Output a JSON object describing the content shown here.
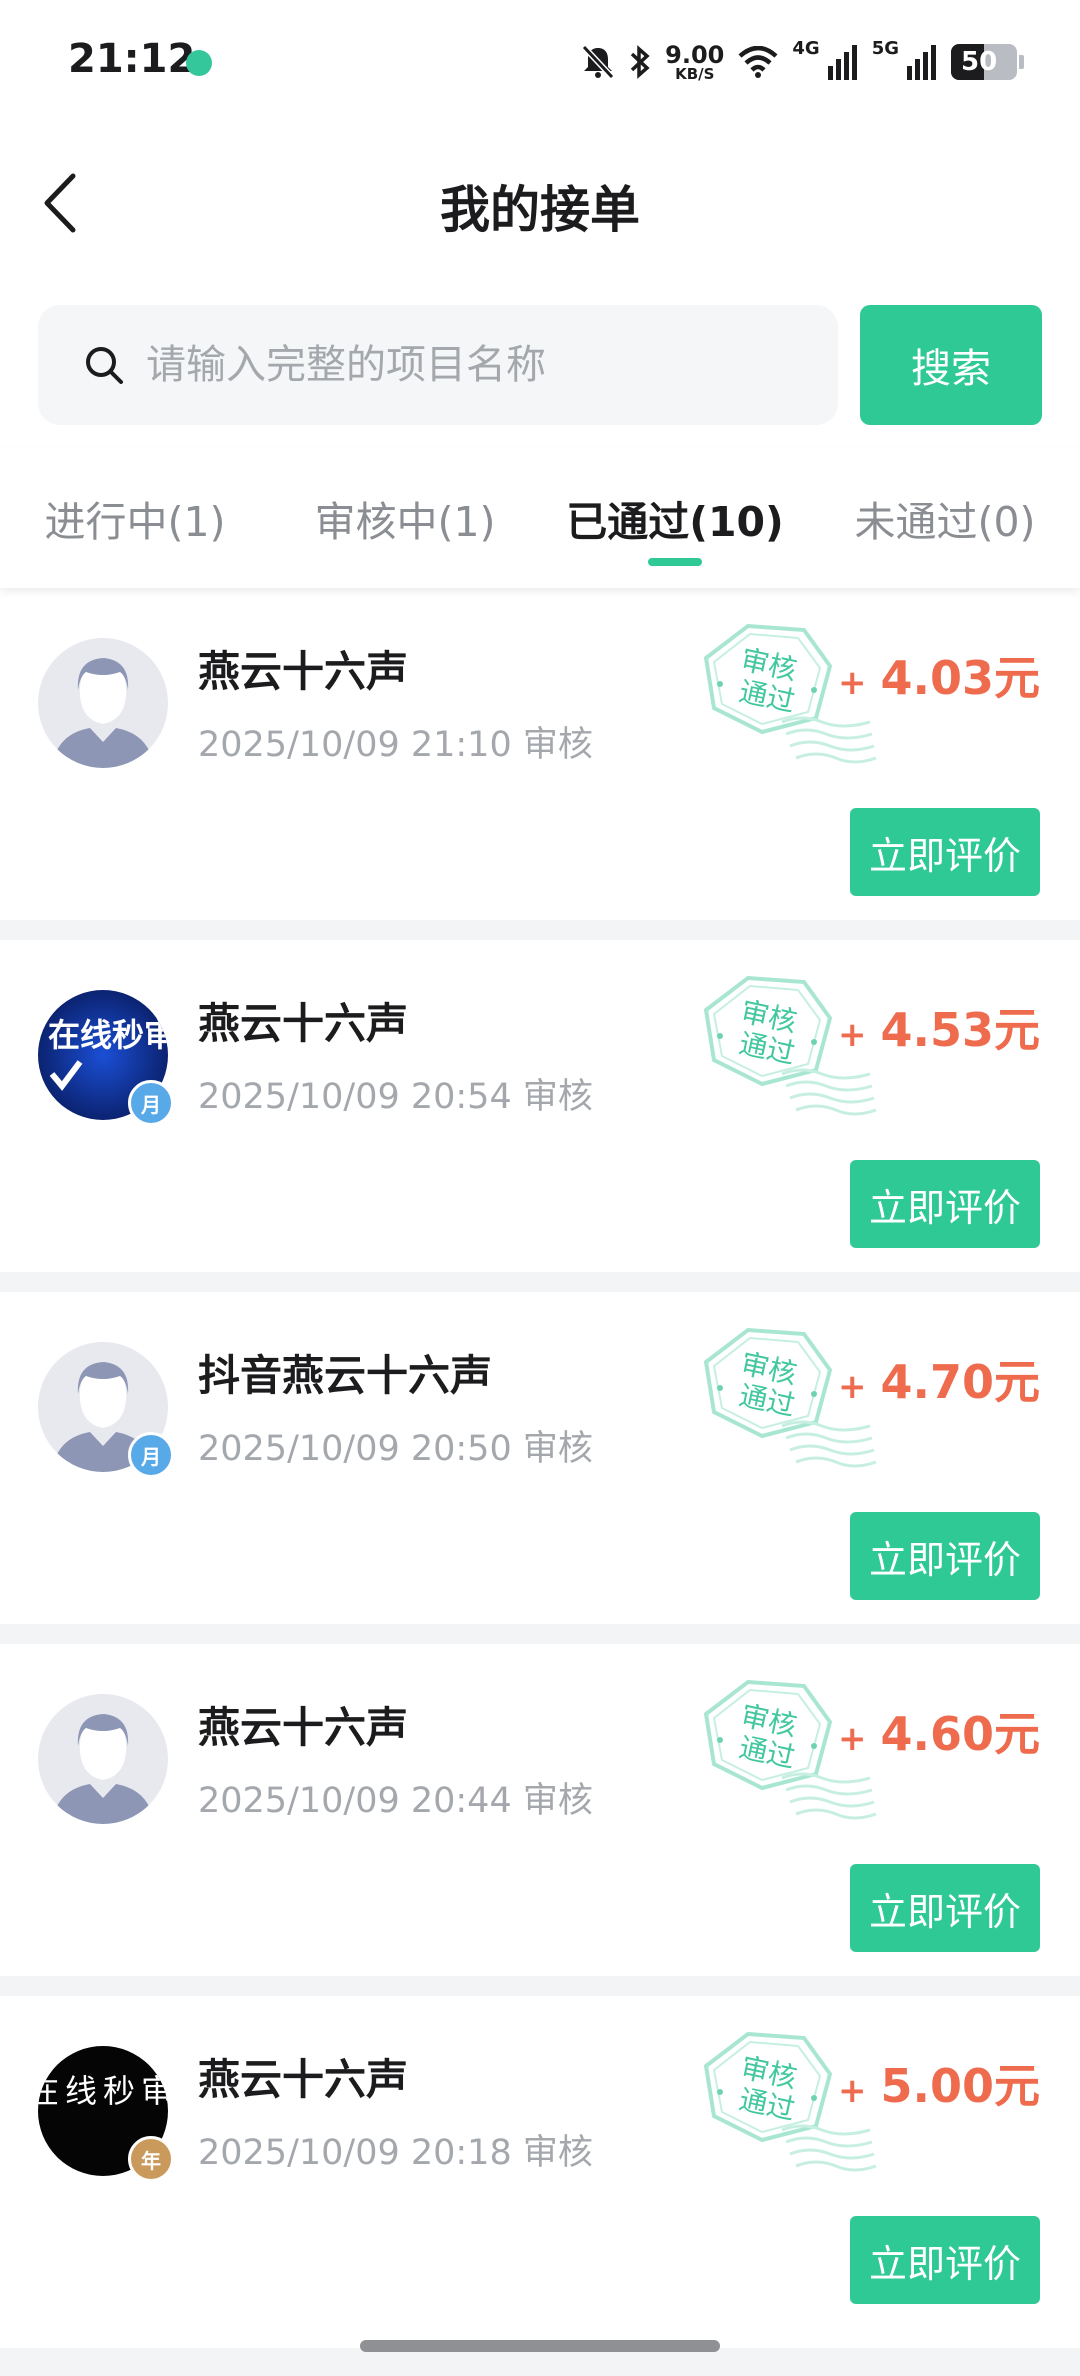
{
  "status_bar": {
    "time": "21:12",
    "speed_value": "9.00",
    "speed_unit": "KB/S",
    "net1": "4G",
    "net2": "5G",
    "battery": "50",
    "icons": [
      "mute-icon",
      "bluetooth-icon",
      "wifi-icon",
      "signal-icon",
      "signal-icon",
      "battery-icon"
    ]
  },
  "header": {
    "title": "我的接单"
  },
  "search": {
    "placeholder": "请输入完整的项目名称",
    "button_label": "搜索"
  },
  "tabs": [
    {
      "label": "进行中(1)",
      "active": false
    },
    {
      "label": "审核中(1)",
      "active": false
    },
    {
      "label": "已通过(10)",
      "active": true
    },
    {
      "label": "未通过(0)",
      "active": false
    }
  ],
  "colors": {
    "accent": "#2ec994",
    "amount": "#ee6b4d",
    "muted": "#a4a8ad"
  },
  "stamp": {
    "line1": "审核",
    "line2": "通过"
  },
  "orders": [
    {
      "name": "燕云十六声",
      "meta": "2025/10/09 21:10 审核",
      "plus": "+",
      "amount": "4.03元",
      "button": "立即评价",
      "avatar": "default-avatar"
    },
    {
      "name": "燕云十六声",
      "meta": "2025/10/09 20:54 审核",
      "plus": "+",
      "amount": "4.53元",
      "button": "立即评价",
      "avatar": "online-review-avatar",
      "avatar_text": "在线秒审",
      "badge": "月"
    },
    {
      "name": "抖音燕云十六声",
      "meta": "2025/10/09 20:50 审核",
      "plus": "+",
      "amount": "4.70元",
      "button": "立即评价",
      "avatar": "default-avatar",
      "badge": "月"
    },
    {
      "name": "燕云十六声",
      "meta": "2025/10/09 20:44 审核",
      "plus": "+",
      "amount": "4.60元",
      "button": "立即评价",
      "avatar": "default-avatar"
    },
    {
      "name": "燕云十六声",
      "meta": "2025/10/09 20:18 审核",
      "plus": "+",
      "amount": "5.00元",
      "button": "立即评价",
      "avatar": "black-text-avatar",
      "avatar_text": "在线秒审",
      "badge": "年"
    }
  ]
}
